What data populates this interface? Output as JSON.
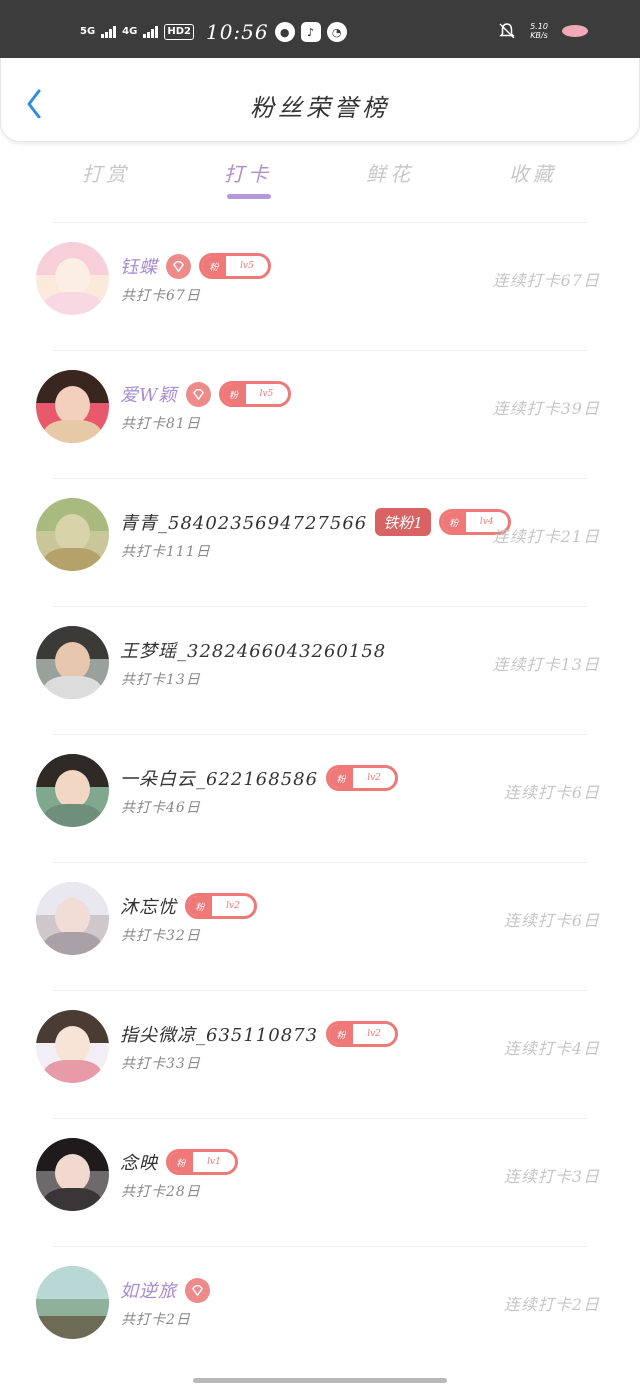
{
  "status_bar": {
    "net1": "5G",
    "net2": "4G",
    "hd": "HD2",
    "time": "10:56",
    "speed": "5.10 KB/s"
  },
  "header": {
    "title": "粉丝荣誉榜"
  },
  "tabs": [
    {
      "label": "打赏",
      "active": false
    },
    {
      "label": "打卡",
      "active": true
    },
    {
      "label": "鲜花",
      "active": false
    },
    {
      "label": "收藏",
      "active": false
    }
  ],
  "colors": {
    "accent": "#b797dc",
    "vip_name": "#a78bd4",
    "badge": "#ef7878",
    "iron_badge": "#d96363"
  },
  "rows": [
    {
      "name": "钰蝶",
      "vip": true,
      "diamond": true,
      "fan_badge": {
        "label": "粉",
        "level": "lv5"
      },
      "total": "共打卡67日",
      "streak": "连续打卡67日"
    },
    {
      "name": "爱W颖",
      "vip": true,
      "diamond": true,
      "fan_badge": {
        "label": "粉",
        "level": "lv5"
      },
      "total": "共打卡81日",
      "streak": "连续打卡39日"
    },
    {
      "name": "青青_5840235694727566",
      "vip": false,
      "iron_badge": "铁粉1",
      "fan_badge": {
        "label": "粉",
        "level": "lv4"
      },
      "total": "共打卡111日",
      "streak": "连续打卡21日"
    },
    {
      "name": "王梦瑶_3282466043260158",
      "vip": false,
      "total": "共打卡13日",
      "streak": "连续打卡13日"
    },
    {
      "name": "一朵白云_622168586",
      "vip": false,
      "fan_badge": {
        "label": "粉",
        "level": "lv2"
      },
      "total": "共打卡46日",
      "streak": "连续打卡6日"
    },
    {
      "name": "沐忘忧",
      "vip": false,
      "fan_badge": {
        "label": "粉",
        "level": "lv2"
      },
      "total": "共打卡32日",
      "streak": "连续打卡6日"
    },
    {
      "name": "指尖微凉_635110873",
      "vip": false,
      "fan_badge": {
        "label": "粉",
        "level": "lv2"
      },
      "total": "共打卡33日",
      "streak": "连续打卡4日"
    },
    {
      "name": "念映",
      "vip": false,
      "fan_badge": {
        "label": "粉",
        "level": "lv1"
      },
      "total": "共打卡28日",
      "streak": "连续打卡3日"
    },
    {
      "name": "如逆旅",
      "vip": true,
      "diamond": true,
      "total": "共打卡2日",
      "streak": "连续打卡2日"
    }
  ]
}
